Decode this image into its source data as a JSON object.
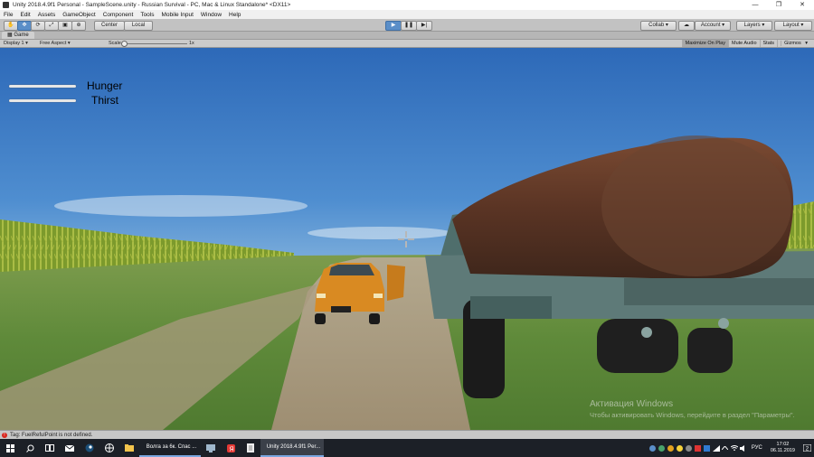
{
  "window": {
    "title": "Unity 2018.4.9f1 Personal - SampleScene.unity - Russian Survival - PC, Mac & Linux Standalone* <DX11>",
    "controls": [
      "—",
      "❐",
      "✕"
    ]
  },
  "menubar": {
    "items": [
      "File",
      "Edit",
      "Assets",
      "GameObject",
      "Component",
      "Tools",
      "Mobile Input",
      "Window",
      "Help"
    ]
  },
  "toolbar": {
    "pivot_label": "Center",
    "space_label": "Local",
    "collab_label": "Collab ▾",
    "account_label": "Account",
    "layers_label": "Layers",
    "layout_label": "Layout"
  },
  "game_tab": {
    "tab_label": "Game",
    "display_label": "Display 1",
    "aspect_label": "Free Aspect",
    "scale_label": "Scale",
    "scale_value": "1x",
    "maximize_label": "Maximize On Play",
    "mute_label": "Mute Audio",
    "stats_label": "Stats",
    "gizmos_label": "Gizmos"
  },
  "hud": {
    "hunger_label": "Hunger",
    "thirst_label": "Thirst",
    "hunger_level": 1.0,
    "thirst_level": 1.0
  },
  "watermark": {
    "title": "Активация Windows",
    "subtitle": "Чтобы активировать Windows, перейдите в раздел \"Параметры\"."
  },
  "console": {
    "message": "Tag: FuelRefulPoint is not defined."
  },
  "taskbar": {
    "browser_label": "Волга за 6к. Спас ...",
    "unity_label": "Unity 2018.4.9f1 Per...",
    "language": "РУС",
    "time": "17:02",
    "date": "06.11.2019",
    "notifications": "2"
  },
  "colors": {
    "play_active": "#5a8ec8",
    "error": "#d8261e",
    "taskbar": "#1c2027"
  }
}
